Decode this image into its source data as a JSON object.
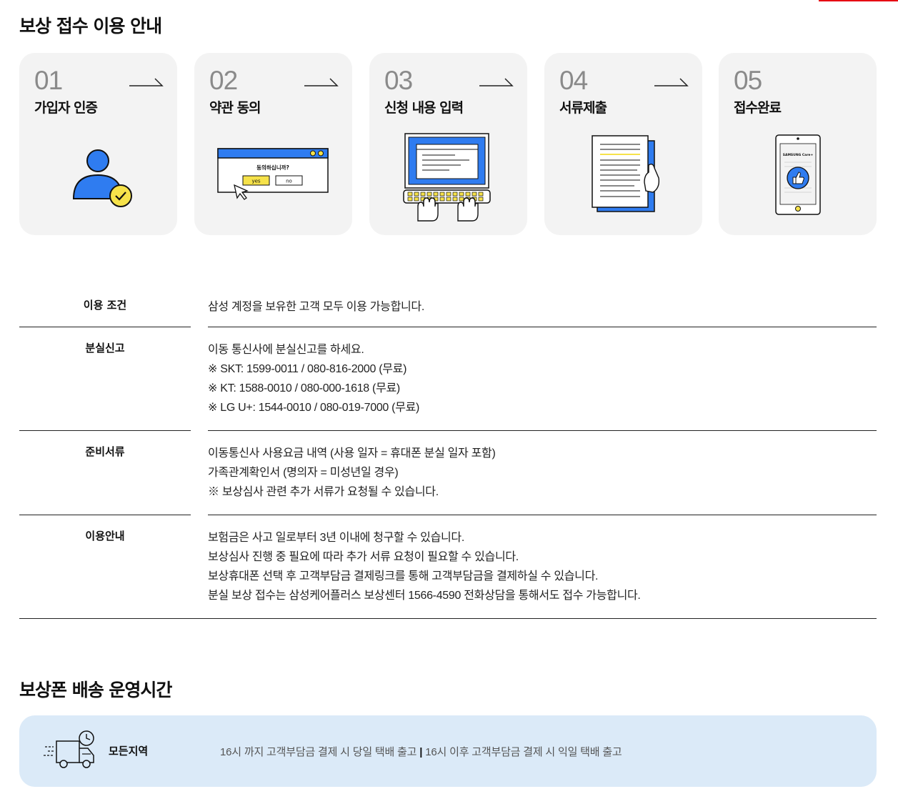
{
  "guide": {
    "title": "보상 접수 이용 안내",
    "steps": [
      {
        "num": "01",
        "title": "가입자 인증"
      },
      {
        "num": "02",
        "title": "약관 동의",
        "dialog_question": "동의하십니까?",
        "yes_label": "yes",
        "no_label": "no"
      },
      {
        "num": "03",
        "title": "신청 내용 입력"
      },
      {
        "num": "04",
        "title": "서류제출"
      },
      {
        "num": "05",
        "title": "접수완료",
        "phone_brand": "SAMSUNG Care+"
      }
    ]
  },
  "info": {
    "rows": [
      {
        "label": "이용 조건",
        "lines": [
          "삼성 계정을 보유한 고객 모두 이용 가능합니다."
        ]
      },
      {
        "label": "분실신고",
        "lines": [
          "이동 통신사에 분실신고를 하세요.",
          "※ SKT: 1599-0011 / 080-816-2000 (무료)",
          "※ KT: 1588-0010 / 080-000-1618 (무료)",
          "※ LG U+: 1544-0010 / 080-019-7000 (무료)"
        ]
      },
      {
        "label": "준비서류",
        "lines": [
          "이동통신사 사용요금 내역 (사용 일자 = 휴대폰 분실 일자 포함)",
          "가족관계확인서 (명의자 = 미성년일 경우)",
          "※ 보상심사 관련 추가 서류가 요청될 수 있습니다."
        ]
      },
      {
        "label": "이용안내",
        "lines": [
          "보험금은 사고 일로부터 3년 이내에 청구할 수 있습니다.",
          "보상심사 진행 중 필요에 따라 추가 서류 요청이 필요할 수 있습니다.",
          "보상휴대폰 선택 후 고객부담금 결제링크를 통해 고객부담금을 결제하실 수 있습니다.",
          "분실 보상 접수는 삼성케어플러스 보상센터 1566-4590 전화상담을 통해서도 접수 가능합니다."
        ]
      }
    ]
  },
  "delivery": {
    "title": "보상폰 배송 운영시간",
    "region": "모든지역",
    "before": "16시 까지 고객부담금 결제 시 당일 택배 출고",
    "separator": "|",
    "after": "16시 이후 고객부담금 결제 시 익일 택배 출고"
  },
  "colors": {
    "accent_blue": "#2f7cf0",
    "accent_yellow": "#f6e24a",
    "card_bg": "#f3f3f3",
    "delivery_bg": "#dbeaf8",
    "top_accent": "#e60012"
  }
}
